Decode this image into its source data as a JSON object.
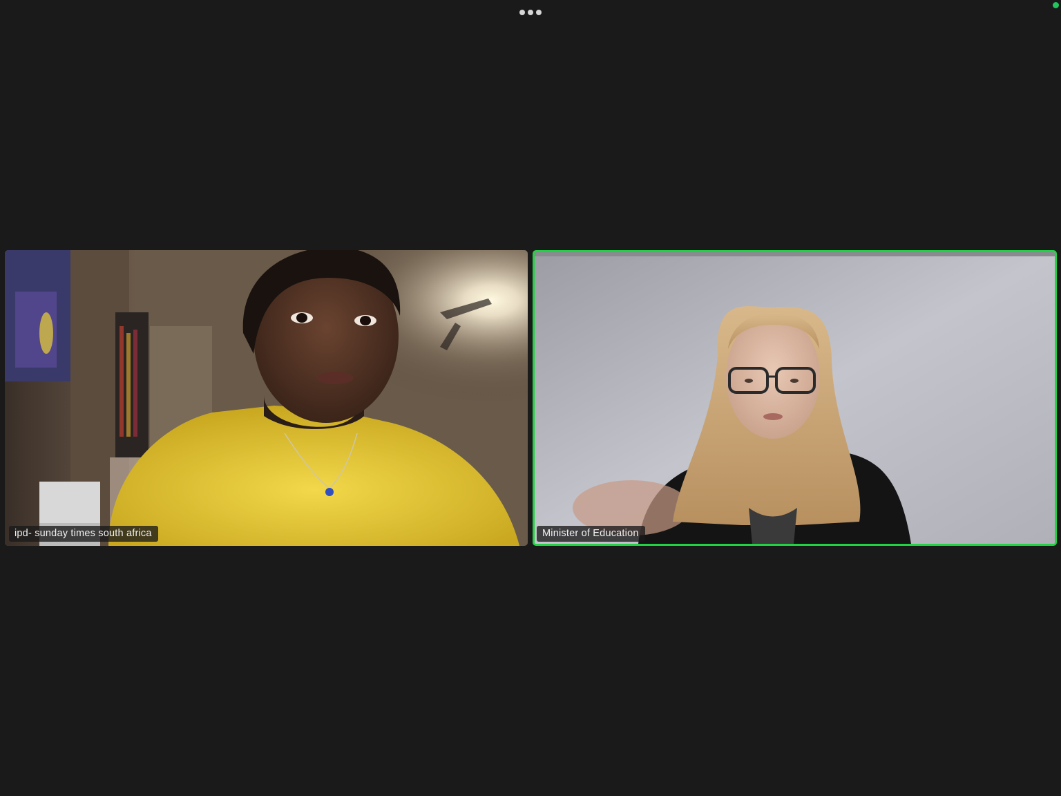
{
  "meeting": {
    "more_icon": "ellipsis-icon",
    "status_color": "#22c55e"
  },
  "participants": [
    {
      "name": "ipd- sunday times south africa",
      "active_speaker": false
    },
    {
      "name": "Minister of Education",
      "active_speaker": true,
      "highlight_color": "#23d244"
    }
  ]
}
